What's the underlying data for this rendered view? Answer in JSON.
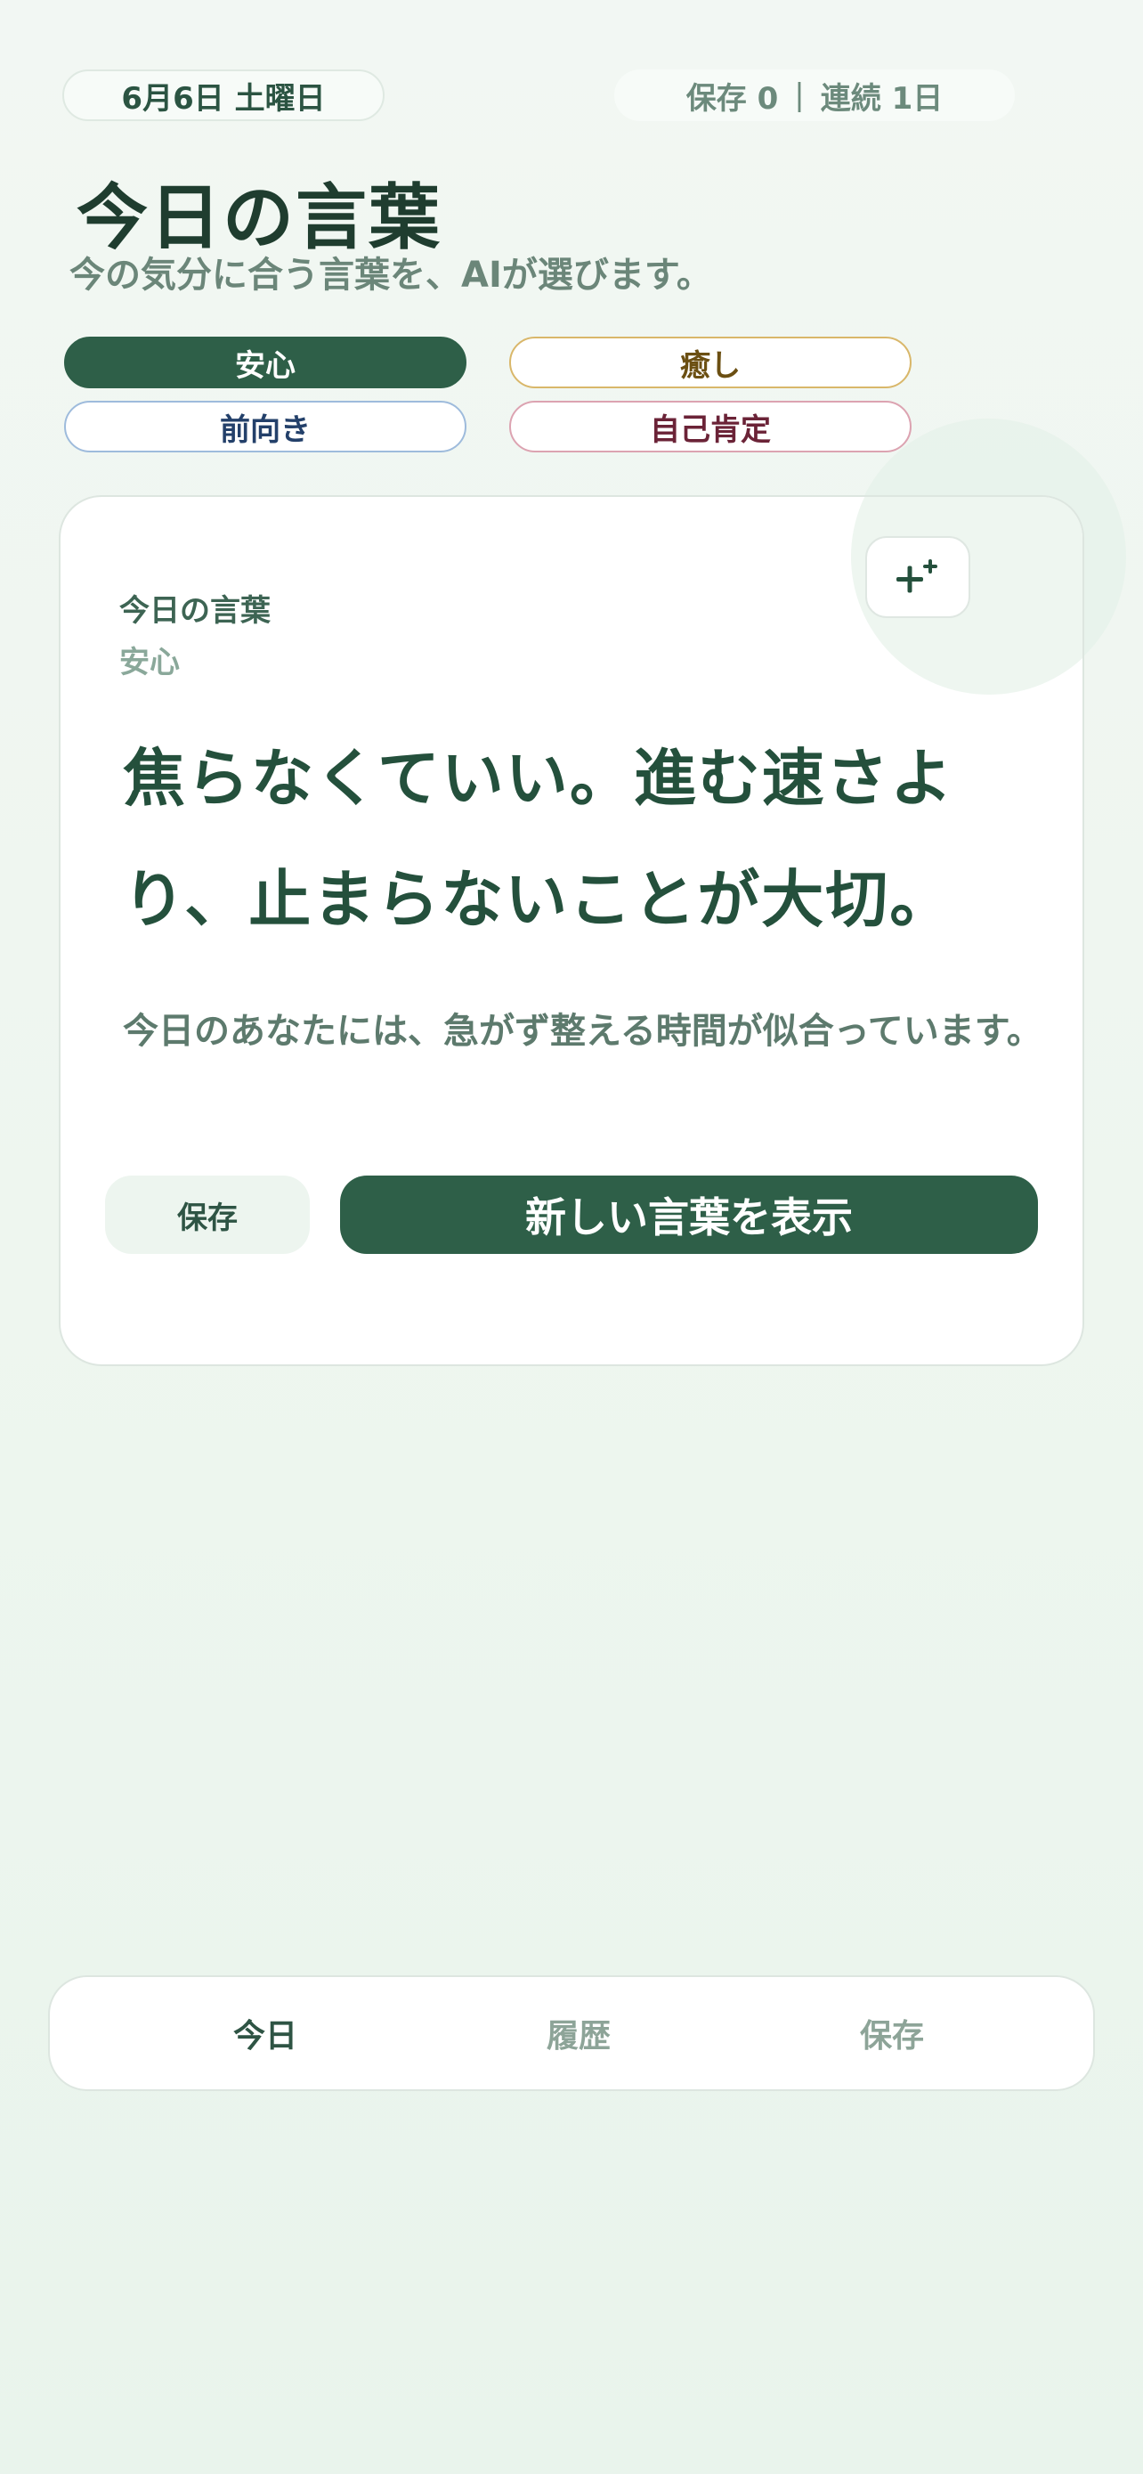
{
  "header": {
    "date": "6月6日 土曜日",
    "stats": {
      "saved": "保存 0",
      "separator": "|",
      "streak": "連続 1日"
    },
    "title": "今日の言葉",
    "subtitle": "今の気分に合う言葉を、AIが選びます。"
  },
  "moods": [
    {
      "label": "安心",
      "selected": true,
      "color": "#2e5f48"
    },
    {
      "label": "癒し",
      "selected": false,
      "color": "#d9b76a"
    },
    {
      "label": "前向き",
      "selected": false,
      "color": "#9ebbdc"
    },
    {
      "label": "自己肯定",
      "selected": false,
      "color": "#dca3b1"
    }
  ],
  "card": {
    "label": "今日の言葉",
    "mood": "安心",
    "sparkle_icon": "sparkle-plus-icon",
    "quote": "焦らなくていい。進む速さより、止まらないことが大切。",
    "note": "今日のあなたには、急がず整える時間が似合っています。",
    "save_label": "保存",
    "new_label": "新しい言葉を表示"
  },
  "nav": {
    "today": "今日",
    "history": "履歴",
    "saved": "保存"
  },
  "colors": {
    "accent": "#2e5f48",
    "background": "#eef6ef",
    "muted_text": "#8da498"
  }
}
